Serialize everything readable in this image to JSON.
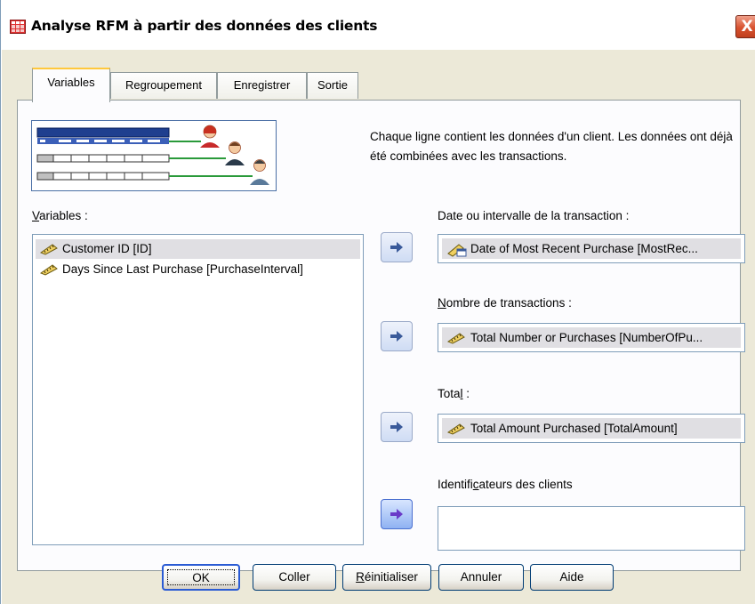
{
  "window": {
    "title": "Analyse RFM à partir des données des clients",
    "close": "X"
  },
  "tabs": [
    {
      "label": "Variables",
      "active": true
    },
    {
      "label": "Regroupement",
      "active": false
    },
    {
      "label": "Enregistrer",
      "active": false
    },
    {
      "label": "Sortie",
      "active": false
    }
  ],
  "description": "Chaque ligne contient les données d'un client. Les données ont déjà été combinées avec les transactions.",
  "variables": {
    "label_prefix": "",
    "label_accel": "V",
    "label_rest": "ariables :",
    "items": [
      {
        "label": "Customer ID [ID]",
        "icon": "ruler-scale-icon",
        "selected": true
      },
      {
        "label": "Days Since Last Purchase [PurchaseInterval]",
        "icon": "ruler-scale-icon",
        "selected": false
      }
    ]
  },
  "targets": {
    "date": {
      "label": "Date ou intervalle de la transaction :",
      "value": "Date of Most Recent Purchase [MostRec..."
    },
    "count": {
      "label_prefix": "",
      "label_accel": "N",
      "label_rest": "ombre de transactions :",
      "value": "Total Number or Purchases [NumberOfPu..."
    },
    "total": {
      "label_prefix": "Tota",
      "label_accel": "l",
      "label_rest": " :",
      "value": "Total Amount Purchased [TotalAmount]"
    },
    "ids": {
      "label_prefix": "Identifi",
      "label_accel": "c",
      "label_rest": "ateurs des clients",
      "value": ""
    }
  },
  "buttons": {
    "ok": "OK",
    "paste": "Coller",
    "reset_accel": "R",
    "reset_rest": "éinitialiser",
    "cancel": "Annuler",
    "help": "Aide"
  },
  "colors": {
    "title_icon": "#e03030",
    "tab_highlight": "#ffc83c",
    "selection": "#e0dfe3",
    "border": "#7f9db9"
  }
}
